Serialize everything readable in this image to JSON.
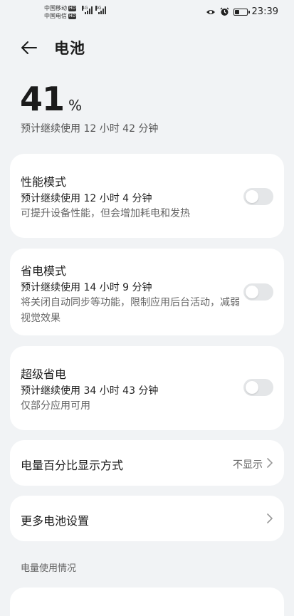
{
  "status_bar": {
    "carrier1": "中国移动",
    "carrier2": "中国电信",
    "hd": "HD",
    "net1": "4G",
    "net2": "4G",
    "time": "23:39",
    "battery_level": 0.41,
    "icons": [
      "eye-icon",
      "alarm-icon",
      "battery-icon"
    ]
  },
  "header": {
    "title": "电池",
    "back_icon": "back-arrow-icon"
  },
  "summary": {
    "percent": "41",
    "unit": "%",
    "remaining": "预计继续使用 12 小时 42 分钟"
  },
  "modes": [
    {
      "title": "性能模式",
      "time": "预计继续使用 12 小时 4 分钟",
      "desc": "可提升设备性能，但会增加耗电和发热",
      "enabled": false
    },
    {
      "title": "省电模式",
      "time": "预计继续使用 14 小时 9 分钟",
      "desc": "将关闭自动同步等功能，限制应用后台活动，减弱视觉效果",
      "enabled": false
    },
    {
      "title": "超级省电",
      "time": "预计继续使用 34 小时 43 分钟",
      "desc": "仅部分应用可用",
      "enabled": false
    }
  ],
  "settings": {
    "percent_display_label": "电量百分比显示方式",
    "percent_display_value": "不显示",
    "more_settings_label": "更多电池设置"
  },
  "section": {
    "usage_header": "电量使用情况"
  },
  "colors": {
    "background": "#f1f3f5",
    "card": "#ffffff",
    "toggle_off": "#e4e6e8"
  }
}
